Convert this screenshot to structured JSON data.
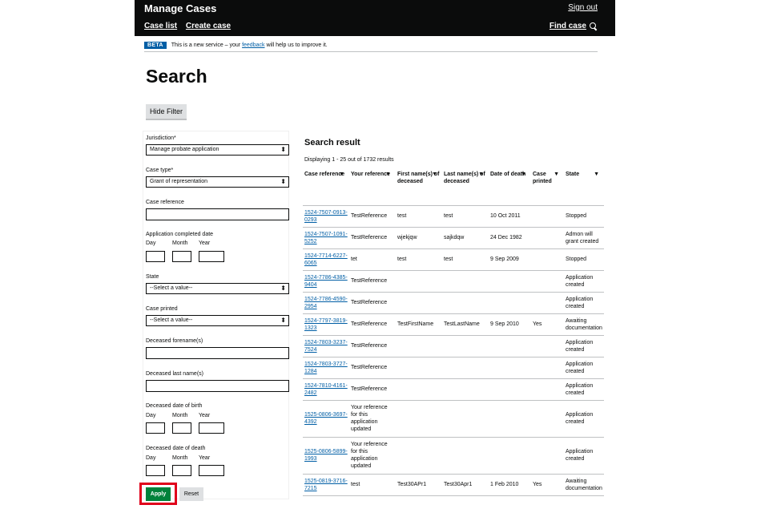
{
  "header": {
    "title": "Manage Cases",
    "sign_out": "Sign out",
    "nav": [
      "Case list",
      "Create case"
    ],
    "find_case": "Find case"
  },
  "beta": {
    "tag": "BETA",
    "text_before": "This is a new service – your",
    "link": "feedback",
    "text_after": "will help us to improve it."
  },
  "page_title": "Search",
  "hide_filter_label": "Hide Filter",
  "filters": {
    "jurisdiction_label": "Jurisdiction*",
    "jurisdiction_value": "Manage probate application",
    "case_type_label": "Case type*",
    "case_type_value": "Grant of representation",
    "case_reference_label": "Case reference",
    "app_completed_label": "Application completed date",
    "day": "Day",
    "month": "Month",
    "year": "Year",
    "state_label": "State",
    "state_value": "--Select a value--",
    "case_printed_label": "Case printed",
    "case_printed_value": "--Select a value--",
    "deceased_forenames_label": "Deceased forename(s)",
    "deceased_lastname_label": "Deceased last name(s)",
    "dob_label": "Deceased date of birth",
    "dod_label": "Deceased date of death",
    "apply_label": "Apply",
    "reset_label": "Reset",
    "select_arrow": "⬍"
  },
  "results": {
    "title": "Search result",
    "count": "Displaying 1 - 25 out of 1732 results",
    "sort_icon": "▼",
    "columns": [
      "Case reference",
      "Your reference",
      "First name(s) of deceased",
      "Last name(s) of deceased",
      "Date of death",
      "Case printed",
      "State"
    ],
    "rows": [
      [
        "1524-7507-0913-0293",
        "TestReference",
        "test",
        "test",
        "10 Oct 2011",
        "",
        "Stopped"
      ],
      [
        "1524-7507-1091-5252",
        "TestReference",
        "wjekjqw",
        "sajkdqw",
        "24 Dec 1982",
        "",
        "Admon will grant created"
      ],
      [
        "1524-7714-6227-6065",
        "tet",
        "test",
        "test",
        "9 Sep 2009",
        "",
        "Stopped"
      ],
      [
        "1524-7786-4385-9404",
        "TestReference",
        "",
        "",
        "",
        "",
        "Application created"
      ],
      [
        "1524-7786-4590-2954",
        "TestReference",
        "",
        "",
        "",
        "",
        "Application created"
      ],
      [
        "1524-7797-3819-1323",
        "TestReference",
        "TestFirstName",
        "TestLastName",
        "9 Sep 2010",
        "Yes",
        "Awaiting documentation"
      ],
      [
        "1524-7803-3237-7524",
        "TestReference",
        "",
        "",
        "",
        "",
        "Application created"
      ],
      [
        "1524-7803-3727-1284",
        "TestReference",
        "",
        "",
        "",
        "",
        "Application created"
      ],
      [
        "1524-7810-4161-2482",
        "TestReference",
        "",
        "",
        "",
        "",
        "Application created"
      ],
      [
        "1525-0806-3697-4392",
        "Your reference for this application updated",
        "",
        "",
        "",
        "",
        "Application created"
      ],
      [
        "1525-0806-5899-1993",
        "Your reference for this application updated",
        "",
        "",
        "",
        "",
        "Application created"
      ],
      [
        "1525-0819-3716-7215",
        "test",
        "Test30APr1",
        "Test30Apr1",
        "1 Feb 2010",
        "Yes",
        "Awaiting documentation"
      ]
    ]
  }
}
